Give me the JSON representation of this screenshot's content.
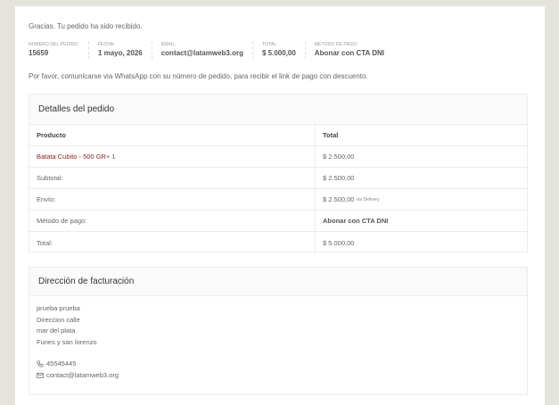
{
  "thanks_text": "Gracias. Tu pedido ha sido recibido.",
  "overview": [
    {
      "label": "NÚMERO DEL PEDIDO:",
      "value": "15659"
    },
    {
      "label": "FECHA:",
      "value": "1 mayo, 2026"
    },
    {
      "label": "EMAIL:",
      "value": "contact@latamweb3.org"
    },
    {
      "label": "TOTAL:",
      "value": "$ 5.000,00"
    },
    {
      "label": "MÉTODO DE PAGO:",
      "value": "Abonar con CTA DNI"
    }
  ],
  "note_text": "Por favor, comunicarse via WhatsApp con su número de pedido, para recibir el link de pago con descuento.",
  "order_details": {
    "title": "Detalles del pedido",
    "col_product": "Producto",
    "col_total": "Total",
    "product_name": "Batata Cubito - 500 GR",
    "product_qty": "× 1",
    "product_total": "$ 2.500,00",
    "subtotal_label": "Subtotal:",
    "subtotal_value": "$ 2.500,00",
    "shipping_label": "Envío:",
    "shipping_value": "$ 2.500,00",
    "shipping_method": "vía Delivery",
    "payment_label": "Método de pago:",
    "payment_value": "Abonar con CTA DNI",
    "total_label": "Total:",
    "total_value": "$ 5.000,00"
  },
  "billing": {
    "title": "Dirección de facturación",
    "name": "prueba prueba",
    "address_1": "Direccion calle",
    "city": "mar del plata",
    "state": "Funes y san lorenzo",
    "phone": "45545445",
    "email": "contact@latamweb3.org"
  },
  "colors": {
    "background": "#e4e4dc",
    "link": "#8a1f1f"
  }
}
